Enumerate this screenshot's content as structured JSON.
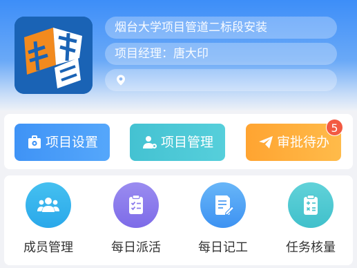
{
  "header": {
    "project_name": "烟台大学项目管道二标段安装",
    "manager": "项目经理：唐大印",
    "location": ""
  },
  "actions": [
    {
      "label": "项目设置",
      "icon": "briefcase-gear-icon"
    },
    {
      "label": "项目管理",
      "icon": "user-gear-icon"
    },
    {
      "label": "审批待办",
      "icon": "paper-plane-icon",
      "badge": "5"
    }
  ],
  "tiles": [
    {
      "label": "成员管理",
      "icon": "group-icon"
    },
    {
      "label": "每日派活",
      "icon": "checklist-icon"
    },
    {
      "label": "每日记工",
      "icon": "document-pen-icon"
    },
    {
      "label": "任务核量",
      "icon": "calculator-icon"
    }
  ],
  "colors": {
    "header_blue": "#3d8ef8",
    "settings_blue": "#3f93f6",
    "manage_teal": "#44c2d2",
    "approval_orange": "#ffa431",
    "badge_red": "#f25a42"
  }
}
